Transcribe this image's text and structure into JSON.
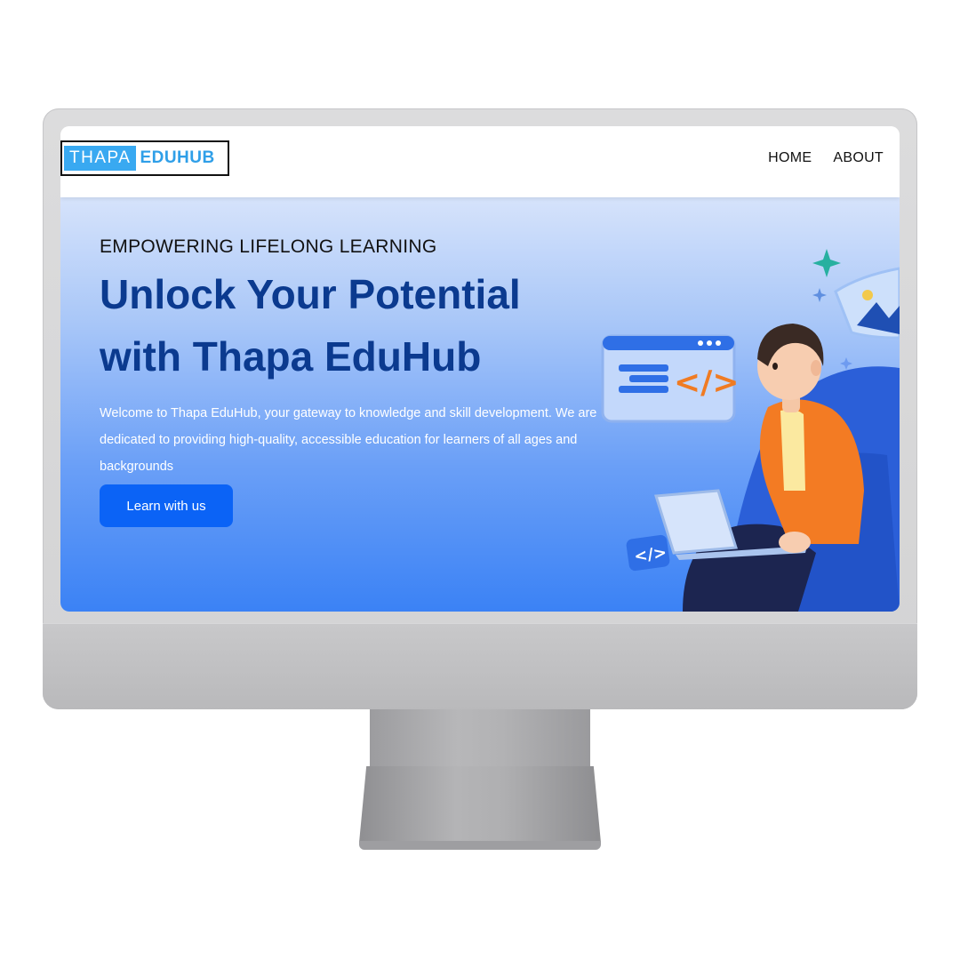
{
  "logo": {
    "part1": "THAPA",
    "part2": "EDUHUB"
  },
  "nav": {
    "items": [
      {
        "label": "HOME"
      },
      {
        "label": "ABOUT"
      }
    ]
  },
  "hero": {
    "eyebrow": "EMPOWERING LIFELONG LEARNING",
    "headline": "Unlock Your Potential with Thapa EduHub",
    "description": "Welcome to Thapa EduHub, your gateway to knowledge and skill development. We are dedicated to providing high-quality, accessible education for learners of all ages and backgrounds",
    "cta_label": "Learn with us"
  },
  "illustration": {
    "code_glyph": "</>"
  },
  "colors": {
    "primary_button": "#0b63f6",
    "headline": "#0b3a8f",
    "logo_blue": "#39a9f1",
    "hero_gradient_top": "#d6e3fb",
    "hero_gradient_bottom": "#3b82f5"
  }
}
